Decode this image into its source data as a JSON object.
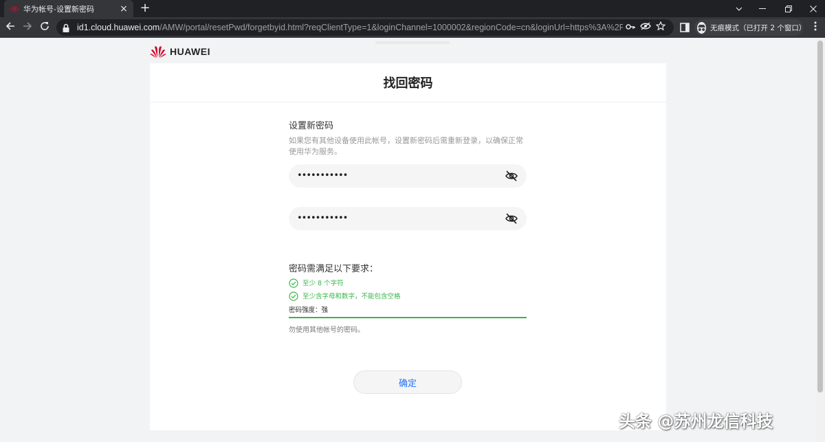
{
  "browser": {
    "tab_title": "华为帐号-设置新密码",
    "tab_close": "×",
    "new_tab": "+",
    "url_host": "id1.cloud.huawei.com",
    "url_path": "/AMW/portal/resetPwd/forgetbyid.html?reqClientType=1&loginChannel=1000002&regionCode=cn&loginUrl=https%3A%2F%...",
    "incognito_label": "无痕模式（已打开 2 个窗口）",
    "icons": [
      "back-icon",
      "forward-icon",
      "reload-icon",
      "lock-icon",
      "key-icon",
      "eye-off-icon",
      "star-icon",
      "side-panel-icon",
      "incognito-icon",
      "menu-icon"
    ]
  },
  "page": {
    "brand": "HUAWEI",
    "card_title": "找回密码",
    "heading": "设置新密码",
    "description": "如果您有其他设备使用此帐号，设置新密码后需重新登录，以确保正常使用华为服务。",
    "password_value": "•••••••••••",
    "confirm_password_value": "•••••••••••",
    "requirements_title": "密码需满足以下要求：",
    "requirements": [
      "至少 8 个字符",
      "至少含字母和数字，不能包含空格"
    ],
    "strength_label": "密码强度：",
    "strength_value": "强",
    "note": "勿使用其他帐号的密码。",
    "confirm_button": "确定",
    "colors": {
      "success": "#39b54a",
      "link": "#256fff",
      "brand": "#cf0a2c"
    }
  },
  "watermark": "头条 @苏州龙信科技"
}
